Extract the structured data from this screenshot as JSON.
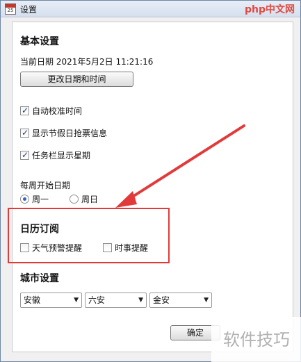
{
  "window": {
    "title": "设置",
    "icon_number": "25"
  },
  "watermark_top": {
    "brand": "php",
    "suffix": "中文网"
  },
  "basic": {
    "heading": "基本设置",
    "current_date_label": "当前日期",
    "current_date_value": "2021年5月2日 11:21:16",
    "change_button": "更改日期和时间"
  },
  "checkboxes": [
    {
      "label": "自动校准时间",
      "checked": true
    },
    {
      "label": "显示节假日抢票信息",
      "checked": true
    },
    {
      "label": "任务栏显示星期",
      "checked": true
    }
  ],
  "week_start": {
    "label": "每周开始日期",
    "options": [
      {
        "label": "周一",
        "selected": true
      },
      {
        "label": "周日",
        "selected": false
      }
    ]
  },
  "subscription": {
    "heading": "日历订阅",
    "items": [
      {
        "label": "天气预警提醒",
        "checked": false
      },
      {
        "label": "时事提醒",
        "checked": false
      }
    ]
  },
  "city": {
    "heading": "城市设置",
    "province": "安徽",
    "city": "六安",
    "district": "金安"
  },
  "footer": {
    "ok_button": "确定"
  },
  "watermark_bottom": "软件技巧",
  "colors": {
    "highlight": "#e23a3a",
    "arrow": "#e23a3a"
  }
}
